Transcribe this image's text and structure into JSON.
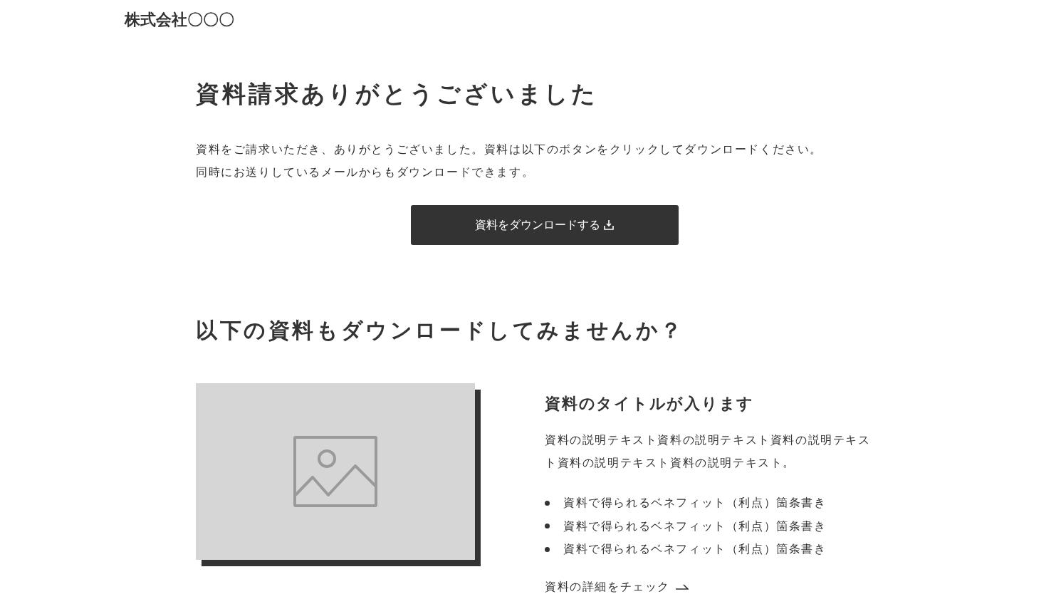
{
  "header": {
    "logo": "株式会社〇〇〇"
  },
  "thanks": {
    "title": "資料請求ありがとうございました",
    "message_lines": [
      "資料をご請求いただき、ありがとうございました。資料は以下のボタンをクリックしてダウンロードください。",
      "同時にお送りしているメールからもダウンロードできます。"
    ],
    "button": "資料をダウンロードする"
  },
  "related": {
    "title": "以下の資料もダウンロードしてみませんか？",
    "items": [
      {
        "title": "資料のタイトルが入ります",
        "description": "資料の説明テキスト資料の説明テキスト資料の説明テキスト資料の説明テキスト資料の説明テキスト。",
        "benefits": [
          "資料で得られるベネフィット（利点）箇条書き",
          "資料で得られるベネフィット（利点）箇条書き",
          "資料で得られるベネフィット（利点）箇条書き"
        ],
        "link": "資料の詳細をチェック"
      }
    ]
  }
}
